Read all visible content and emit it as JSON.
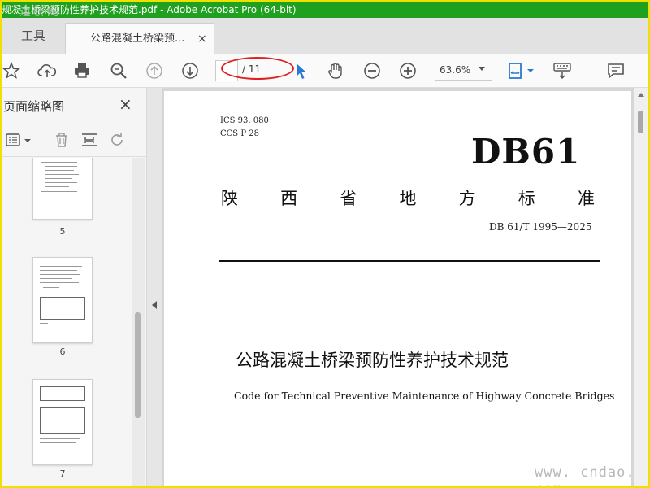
{
  "window": {
    "title": "规凝土桥梁预防性养护技术规范.pdf - Adobe Acrobat Pro (64-bit)",
    "watermark_top": "道桥网"
  },
  "tabs": {
    "tools_label": "工具",
    "doc_label": "公路混凝土桥梁预...",
    "close_symbol": "×"
  },
  "toolbar": {
    "page_current": "",
    "page_total": "/ 11",
    "zoom_value": "63.6%",
    "icons": [
      "star-icon",
      "cloud-upload-icon",
      "print-icon",
      "zoom-search-icon",
      "page-up-icon",
      "page-down-icon",
      "select-arrow-icon",
      "hand-icon",
      "zoom-out-icon",
      "zoom-in-icon",
      "fit-page-icon",
      "keyboard-icon",
      "comment-icon"
    ],
    "accent_blue": "#2a7ad5",
    "highlight_red": "#e02020"
  },
  "sidebar": {
    "title": "页面缩略图",
    "close_symbol": "×",
    "thumbnails": [
      {
        "label": "5"
      },
      {
        "label": "6"
      },
      {
        "label": "7"
      }
    ]
  },
  "document": {
    "ics": "ICS   93. 080",
    "ccs": "CCS P 28",
    "code": "DB61",
    "province_chars": [
      "陕",
      "西",
      "省",
      "地",
      "方",
      "标",
      "准"
    ],
    "standard_number": "DB 61/T  1995—2025",
    "title_zh": "公路混凝土桥梁预防性养护技术规范",
    "title_en": "Code for Technical Preventive Maintenance of Highway Concrete Bridges"
  },
  "watermark_bottom": "www. cndao. com"
}
